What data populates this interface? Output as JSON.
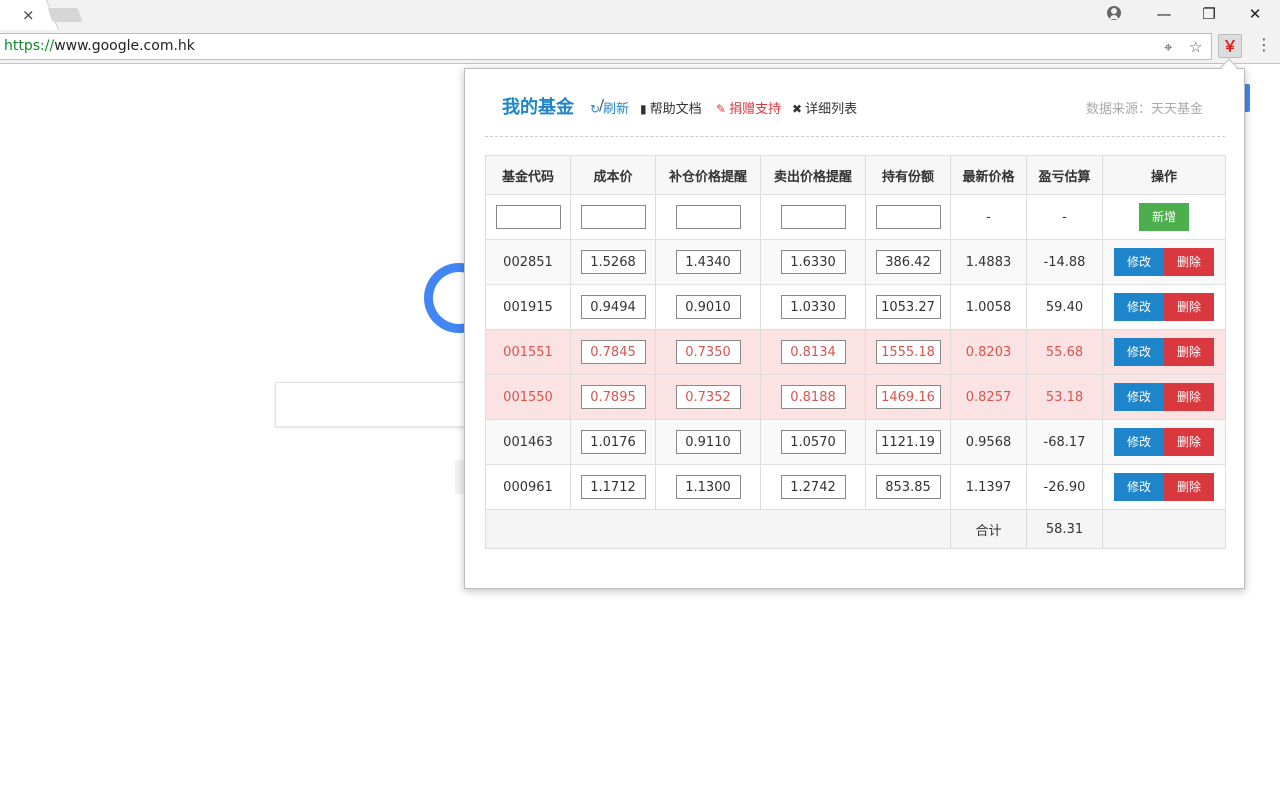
{
  "browser": {
    "tab_close": "×",
    "window_controls": {
      "minimize": "—",
      "maximize": "❐",
      "close": "✕"
    },
    "url_scheme": "https://",
    "url_rest": "www.google.com.hk",
    "extension_label": "￥",
    "icons": [
      "location-icon",
      "star-icon",
      "menu-icon",
      "profile-icon"
    ]
  },
  "popup": {
    "title": "我的基金",
    "separator": "/",
    "links": [
      {
        "label": "刷新",
        "icon": "refresh-icon",
        "color": "#1e85cb"
      },
      {
        "label": "帮助文档",
        "icon": "book-icon",
        "color": "#333333"
      },
      {
        "label": "捐赠支持",
        "icon": "pencil-icon",
        "color": "#d9393e"
      },
      {
        "label": "详细列表",
        "icon": "expand-icon",
        "color": "#333333"
      }
    ],
    "source": "数据来源：天天基金",
    "headers": [
      "基金代码",
      "成本价",
      "补仓价格提醒",
      "卖出价格提醒",
      "持有份额",
      "最新价格",
      "盈亏估算",
      "操作"
    ],
    "new_row": {
      "latest": "-",
      "profit": "-",
      "add_label": "新增"
    },
    "rows": [
      {
        "code": "002851",
        "cost": "1.5268",
        "buy_alert": "1.4340",
        "sell_alert": "1.6330",
        "shares": "386.42",
        "latest": "1.4883",
        "profit": "-14.88",
        "highlight": false
      },
      {
        "code": "001915",
        "cost": "0.9494",
        "buy_alert": "0.9010",
        "sell_alert": "1.0330",
        "shares": "1053.27",
        "latest": "1.0058",
        "profit": "59.40",
        "highlight": false
      },
      {
        "code": "001551",
        "cost": "0.7845",
        "buy_alert": "0.7350",
        "sell_alert": "0.8134",
        "shares": "1555.18",
        "latest": "0.8203",
        "profit": "55.68",
        "highlight": true
      },
      {
        "code": "001550",
        "cost": "0.7895",
        "buy_alert": "0.7352",
        "sell_alert": "0.8188",
        "shares": "1469.16",
        "latest": "0.8257",
        "profit": "53.18",
        "highlight": true
      },
      {
        "code": "001463",
        "cost": "1.0176",
        "buy_alert": "0.9110",
        "sell_alert": "1.0570",
        "shares": "1121.19",
        "latest": "0.9568",
        "profit": "-68.17",
        "highlight": false
      },
      {
        "code": "000961",
        "cost": "1.1712",
        "buy_alert": "1.1300",
        "sell_alert": "1.2742",
        "shares": "853.85",
        "latest": "1.1397",
        "profit": "-26.90",
        "highlight": false
      }
    ],
    "edit_label": "修改",
    "delete_label": "删除",
    "total_label": "合计",
    "total_value": "58.31",
    "colors": {
      "accent": "#1e85cb",
      "add": "#4cae4c",
      "delete": "#d9393e",
      "highlight_bg": "#fbe3e4",
      "highlight_text": "#d9534f"
    }
  }
}
